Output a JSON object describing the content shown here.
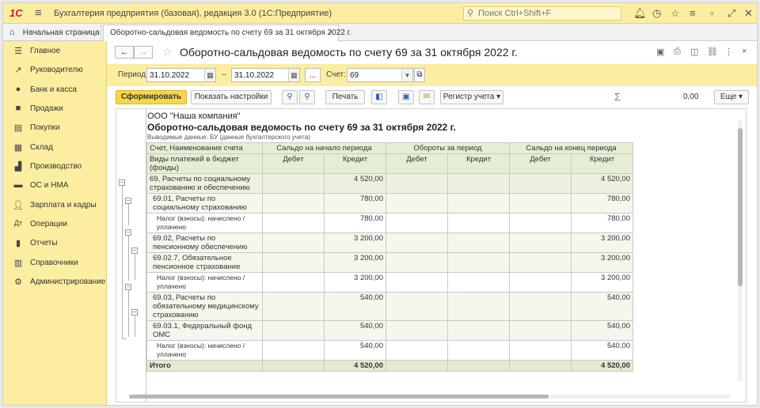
{
  "window": {
    "logo": "1С",
    "title": "Бухгалтерия предприятия (базовая), редакция 3.0  (1С:Предприятие)",
    "search_placeholder": "Поиск Ctrl+Shift+F"
  },
  "tabs": {
    "home": "Начальная страница",
    "active": "Оборотно-сальдовая ведомость по счету 69 за 31 октября 2022 г."
  },
  "sidebar": {
    "items": [
      {
        "label": "Главное",
        "icon": "menu-icon"
      },
      {
        "label": "Руководителю",
        "icon": "trend-icon"
      },
      {
        "label": "Банк и касса",
        "icon": "bank-icon"
      },
      {
        "label": "Продажи",
        "icon": "cart-icon"
      },
      {
        "label": "Покупки",
        "icon": "purchases-icon"
      },
      {
        "label": "Склад",
        "icon": "warehouse-icon"
      },
      {
        "label": "Производство",
        "icon": "production-icon"
      },
      {
        "label": "ОС и НМА",
        "icon": "assets-icon"
      },
      {
        "label": "Зарплата и кадры",
        "icon": "people-icon"
      },
      {
        "label": "Операции",
        "icon": "operations-icon"
      },
      {
        "label": "Отчеты",
        "icon": "reports-icon"
      },
      {
        "label": "Справочники",
        "icon": "books-icon"
      },
      {
        "label": "Администрирование",
        "icon": "gear-icon"
      }
    ]
  },
  "header": {
    "title": "Оборотно-сальдовая ведомость по счету 69 за 31 октября 2022 г."
  },
  "params": {
    "period_label": "Период:",
    "date_from": "31.10.2022",
    "dash": "–",
    "date_to": "31.10.2022",
    "ellipsis": "...",
    "account_label": "Счет:",
    "account": "69"
  },
  "toolbar": {
    "generate": "Сформировать",
    "settings": "Показать настройки",
    "print": "Печать",
    "registry": "Регистр учета",
    "sum_symbol": "Σ",
    "sum_value": "0,00",
    "more": "Еще"
  },
  "report": {
    "company": "ООО \"Наша компания\"",
    "title": "Оборотно-сальдовая ведомость по счету 69 за 31 октября 2022 г.",
    "subtitle": "Выводимые данные:  БУ (данные бухгалтерского учета)",
    "head": {
      "account": "Счет, Наименование счета",
      "budget": "Виды платежей в бюджет (фонды)",
      "opening": "Сальдо на начало периода",
      "turnover": "Обороты за период",
      "closing": "Сальдо на конец периода",
      "debit": "Дебет",
      "credit": "Кредит"
    },
    "rows": [
      {
        "level": 1,
        "name": "69, Расчеты по социальному страхованию и обеспечению",
        "ob_d": "",
        "ob_c": "4 520,00",
        "t_d": "",
        "t_c": "",
        "cb_d": "",
        "cb_c": "4 520,00"
      },
      {
        "level": 2,
        "name": "69.01, Расчеты по социальному страхованию",
        "ob_d": "",
        "ob_c": "780,00",
        "t_d": "",
        "t_c": "",
        "cb_d": "",
        "cb_c": "780,00"
      },
      {
        "level": 3,
        "name": "Налог (взносы): начислено / уплачено",
        "ob_d": "",
        "ob_c": "780,00",
        "t_d": "",
        "t_c": "",
        "cb_d": "",
        "cb_c": "780,00"
      },
      {
        "level": 2,
        "name": "69.02, Расчеты по пенсионному обеспечению",
        "ob_d": "",
        "ob_c": "3 200,00",
        "t_d": "",
        "t_c": "",
        "cb_d": "",
        "cb_c": "3 200,00"
      },
      {
        "level": 2,
        "name": "69.02.7, Обязательное пенсионное страхование",
        "ob_d": "",
        "ob_c": "3 200,00",
        "t_d": "",
        "t_c": "",
        "cb_d": "",
        "cb_c": "3 200,00"
      },
      {
        "level": 3,
        "name": "Налог (взносы): начислено / уплачено",
        "ob_d": "",
        "ob_c": "3 200,00",
        "t_d": "",
        "t_c": "",
        "cb_d": "",
        "cb_c": "3 200,00"
      },
      {
        "level": 2,
        "name": "69.03, Расчеты по обязательному медицинскому страхованию",
        "ob_d": "",
        "ob_c": "540,00",
        "t_d": "",
        "t_c": "",
        "cb_d": "",
        "cb_c": "540,00"
      },
      {
        "level": 2,
        "name": "69.03.1, Федеральный фонд ОМС",
        "ob_d": "",
        "ob_c": "540,00",
        "t_d": "",
        "t_c": "",
        "cb_d": "",
        "cb_c": "540,00"
      },
      {
        "level": 3,
        "name": "Налог (взносы): начислено / уплачено",
        "ob_d": "",
        "ob_c": "540,00",
        "t_d": "",
        "t_c": "",
        "cb_d": "",
        "cb_c": "540,00"
      }
    ],
    "total": {
      "name": "Итого",
      "ob_d": "",
      "ob_c": "4 520,00",
      "t_d": "",
      "t_c": "",
      "cb_d": "",
      "cb_c": "4 520,00"
    }
  }
}
